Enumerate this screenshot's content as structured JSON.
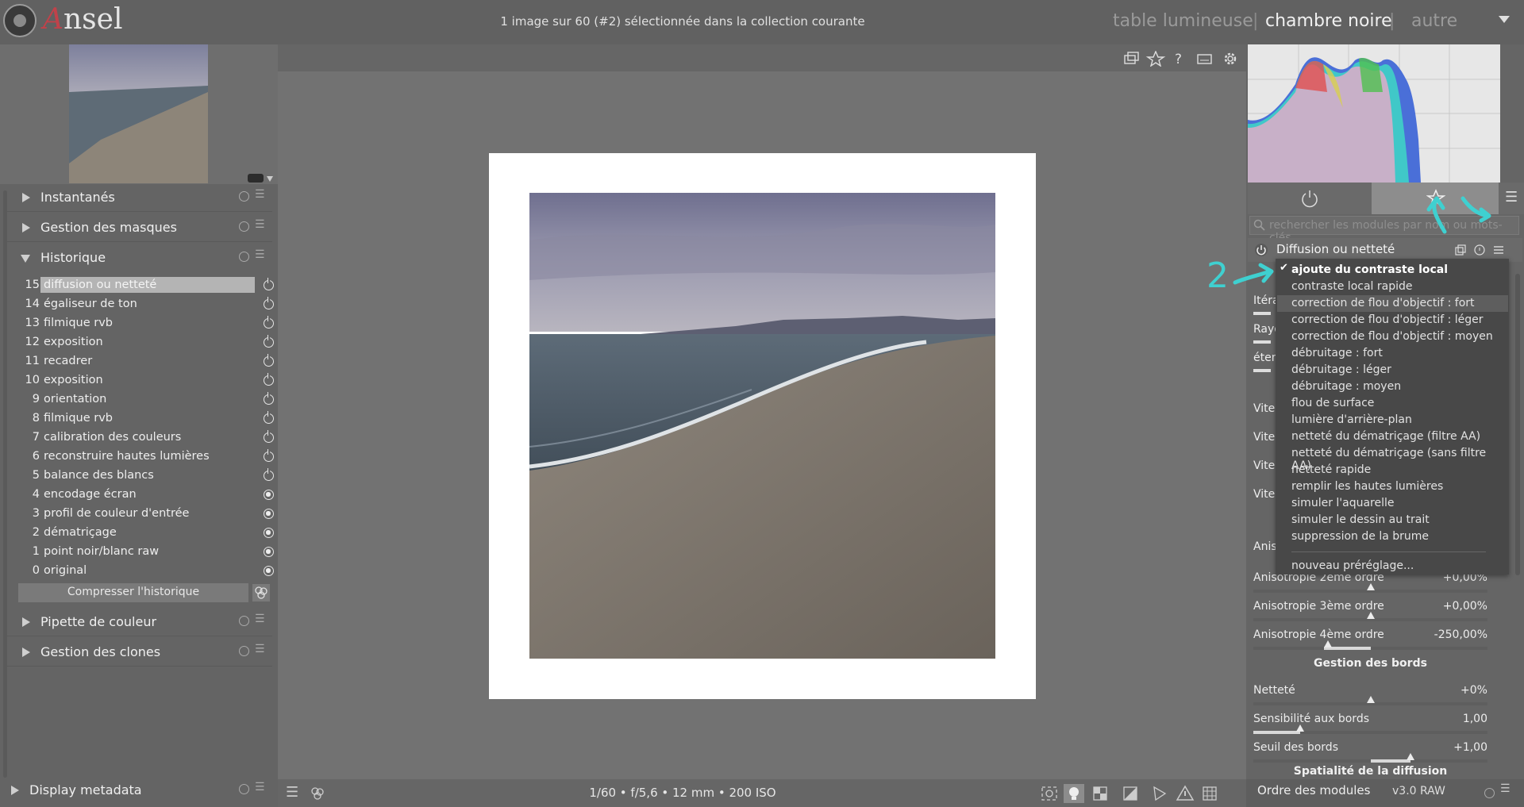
{
  "app": {
    "name_initial": "A",
    "name_rest": "nsel"
  },
  "header": {
    "selection_info": "1 image sur 60 (#2) sélectionnée dans la collection courante",
    "views": [
      "table lumineuse",
      "chambre noire",
      "autre"
    ],
    "active_view": "chambre noire",
    "separator": "|"
  },
  "left_panel": {
    "modules": {
      "snapshots": "Instantanés",
      "masks": "Gestion des masques",
      "history": "Historique",
      "color_picker": "Pipette de couleur",
      "clones": "Gestion des clones",
      "metadata": "Display metadata"
    },
    "history_items": [
      {
        "num": "15",
        "name": "diffusion ou netteté",
        "state": "off"
      },
      {
        "num": "14",
        "name": "égaliseur de ton",
        "state": "off"
      },
      {
        "num": "13",
        "name": "filmique rvb",
        "state": "off"
      },
      {
        "num": "12",
        "name": "exposition",
        "state": "off"
      },
      {
        "num": "11",
        "name": "recadrer",
        "state": "off"
      },
      {
        "num": "10",
        "name": "exposition",
        "state": "off"
      },
      {
        "num": "9",
        "name": "orientation",
        "state": "off"
      },
      {
        "num": "8",
        "name": "filmique rvb",
        "state": "off"
      },
      {
        "num": "7",
        "name": "calibration des couleurs",
        "state": "off"
      },
      {
        "num": "6",
        "name": "reconstruire hautes lumières",
        "state": "off"
      },
      {
        "num": "5",
        "name": "balance des blancs",
        "state": "off"
      },
      {
        "num": "4",
        "name": "encodage écran",
        "state": "on"
      },
      {
        "num": "3",
        "name": "profil de couleur d'entrée",
        "state": "on"
      },
      {
        "num": "2",
        "name": "dématriçage",
        "state": "on"
      },
      {
        "num": "1",
        "name": "point noir/blanc raw",
        "state": "on"
      },
      {
        "num": "0",
        "name": "original",
        "state": "on"
      }
    ],
    "compress_button": "Compresser l'historique"
  },
  "center": {
    "exif": "1/60 • f/5,6 • 12 mm • 200 ISO"
  },
  "right_panel": {
    "search_placeholder": "rechercher les modules par nom ou mots-clés",
    "module_title": "Diffusion ou netteté",
    "partial_labels": [
      "Itéra",
      "Rayo",
      "éten",
      "Vites",
      "Vites",
      "Vites",
      "Vites",
      "Anis"
    ],
    "sliders": [
      {
        "label": "Anisotropie 2ème ordre",
        "value": "+0,00%",
        "level": 0.5
      },
      {
        "label": "Anisotropie 3ème ordre",
        "value": "+0,00%",
        "level": 0.5
      },
      {
        "label": "Anisotropie 4ème ordre",
        "value": "-250,00%",
        "level": 0.0
      },
      {
        "label": "Netteté",
        "value": "+0%",
        "level": 0.5
      },
      {
        "label": "Sensibilité aux bords",
        "value": "1,00",
        "level": 0.2
      },
      {
        "label": "Seuil des bords",
        "value": "+1,00",
        "level": 0.67
      }
    ],
    "sections": {
      "edges": "Gestion des bords",
      "spatiality": "Spatialité de la diffusion"
    },
    "presets": [
      "ajoute du contraste local",
      "contraste local rapide",
      "correction de flou d'objectif : fort",
      "correction de flou d'objectif : léger",
      "correction de flou d'objectif : moyen",
      "débruitage : fort",
      "débruitage : léger",
      "débruitage : moyen",
      "flou de surface",
      "lumière d'arrière-plan",
      "netteté du dématriçage (filtre AA)",
      "netteté du dématriçage (sans filtre AA)",
      "netteté rapide",
      "remplir les hautes lumières",
      "simuler l'aquarelle",
      "simuler le dessin au trait",
      "suppression de la brume"
    ],
    "new_preset": "nouveau préréglage...",
    "bottom": {
      "module_order": "Ordre des modules",
      "version": "v3.0 RAW"
    }
  },
  "colors": {
    "annotation": "#3fd0d0",
    "selected_row": "#b4b4b4"
  },
  "annotations": {
    "step_number": "2"
  }
}
